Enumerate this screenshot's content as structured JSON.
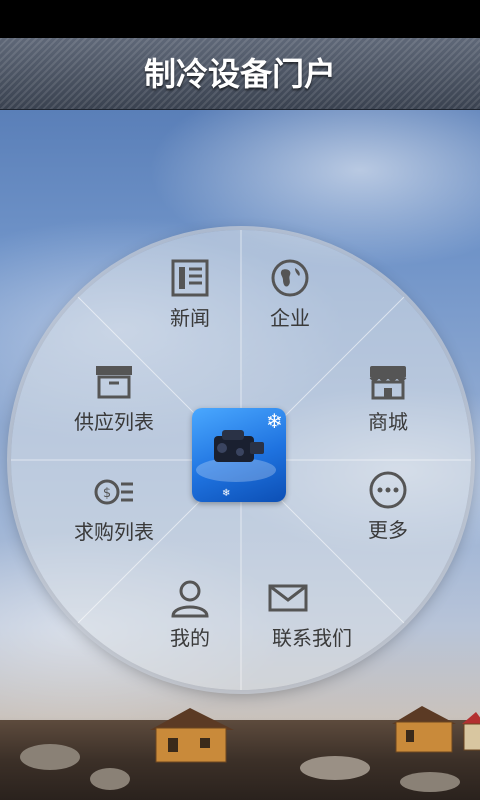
{
  "header": {
    "title": "制冷设备门户"
  },
  "menu": {
    "items": [
      {
        "id": "news",
        "label": "新闻",
        "icon": "newspaper-icon"
      },
      {
        "id": "company",
        "label": "企业",
        "icon": "globe-icon"
      },
      {
        "id": "mall",
        "label": "商城",
        "icon": "store-icon"
      },
      {
        "id": "more",
        "label": "更多",
        "icon": "more-dots-icon"
      },
      {
        "id": "contact",
        "label": "联系我们",
        "icon": "envelope-icon"
      },
      {
        "id": "mine",
        "label": "我的",
        "icon": "user-icon"
      },
      {
        "id": "buy",
        "label": "求购列表",
        "icon": "coin-list-icon"
      },
      {
        "id": "supply",
        "label": "供应列表",
        "icon": "archive-box-icon"
      }
    ]
  },
  "center": {
    "icon": "refrigeration-compressor-logo"
  },
  "colors": {
    "title_text": "#ffffff",
    "menu_text": "#3a3a3a",
    "logo_blue": "#1f73e0"
  }
}
